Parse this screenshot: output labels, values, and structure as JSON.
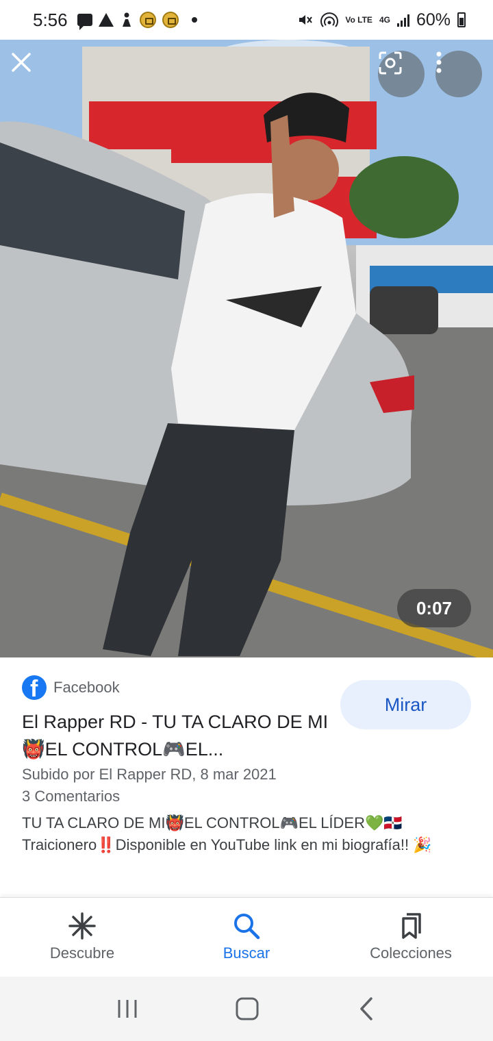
{
  "status_bar": {
    "time": "5:56",
    "volte": "Vo LTE",
    "network": "4G",
    "battery": "60%"
  },
  "media": {
    "duration": "0:07",
    "close_icon": "close-icon",
    "lens_icon": "lens-icon",
    "more_icon": "more-vert-icon"
  },
  "result": {
    "source": "Facebook",
    "title": "El Rapper RD - TU TA CLARO DE MI👹EL CONTROL🎮EL...",
    "uploaded": "Subido por El Rapper RD, 8 mar 2021",
    "comments": "3 Comentarios",
    "description": "TU TA CLARO DE MI👹EL CONTROL🎮EL LÍDER💚🇩🇴 Traicionero‼️Disponible en YouTube link en mi biografía!! 🎉",
    "watch_label": "Mirar"
  },
  "bottom_nav": {
    "items": [
      {
        "label": "Descubre",
        "icon": "asterisk-icon",
        "active": false
      },
      {
        "label": "Buscar",
        "icon": "search-icon",
        "active": true
      },
      {
        "label": "Colecciones",
        "icon": "bookmarks-icon",
        "active": false
      }
    ]
  },
  "colors": {
    "accent": "#1a73e8",
    "facebook": "#1877f2",
    "watch_bg": "#e8f0fe"
  }
}
